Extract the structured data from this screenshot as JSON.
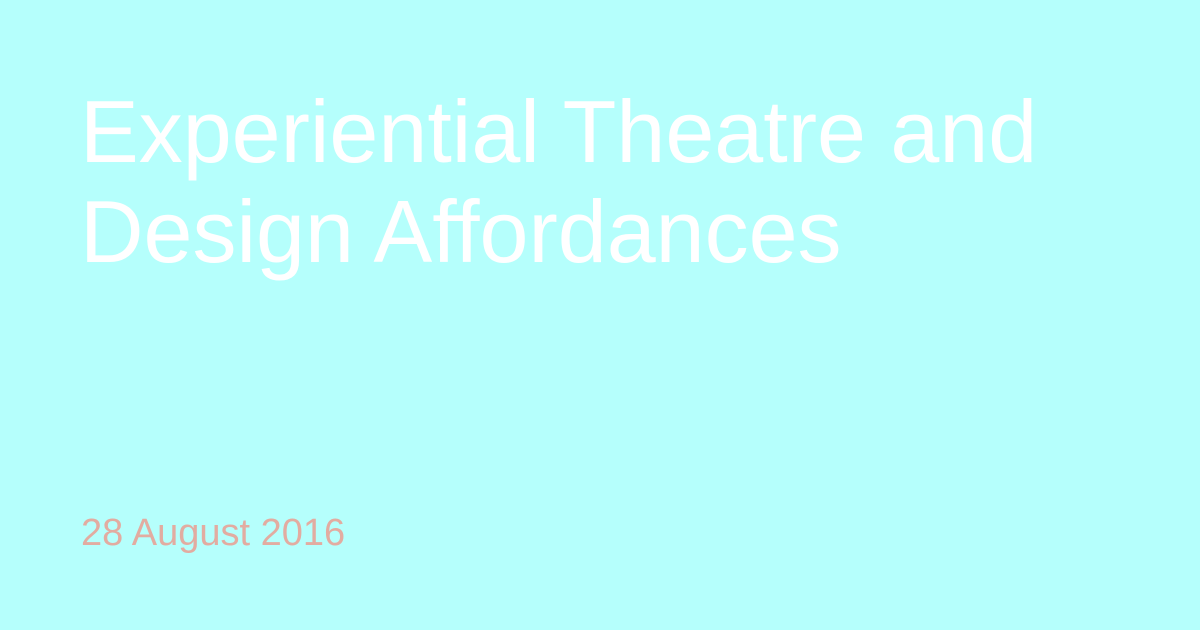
{
  "card": {
    "background_color": "#b5fffc",
    "title_color": "#ffffff",
    "date_color": "#e2aca1",
    "title_lines": [
      "Experiential Theatre and",
      "Design Affordances"
    ],
    "date": "28 August 2016"
  }
}
